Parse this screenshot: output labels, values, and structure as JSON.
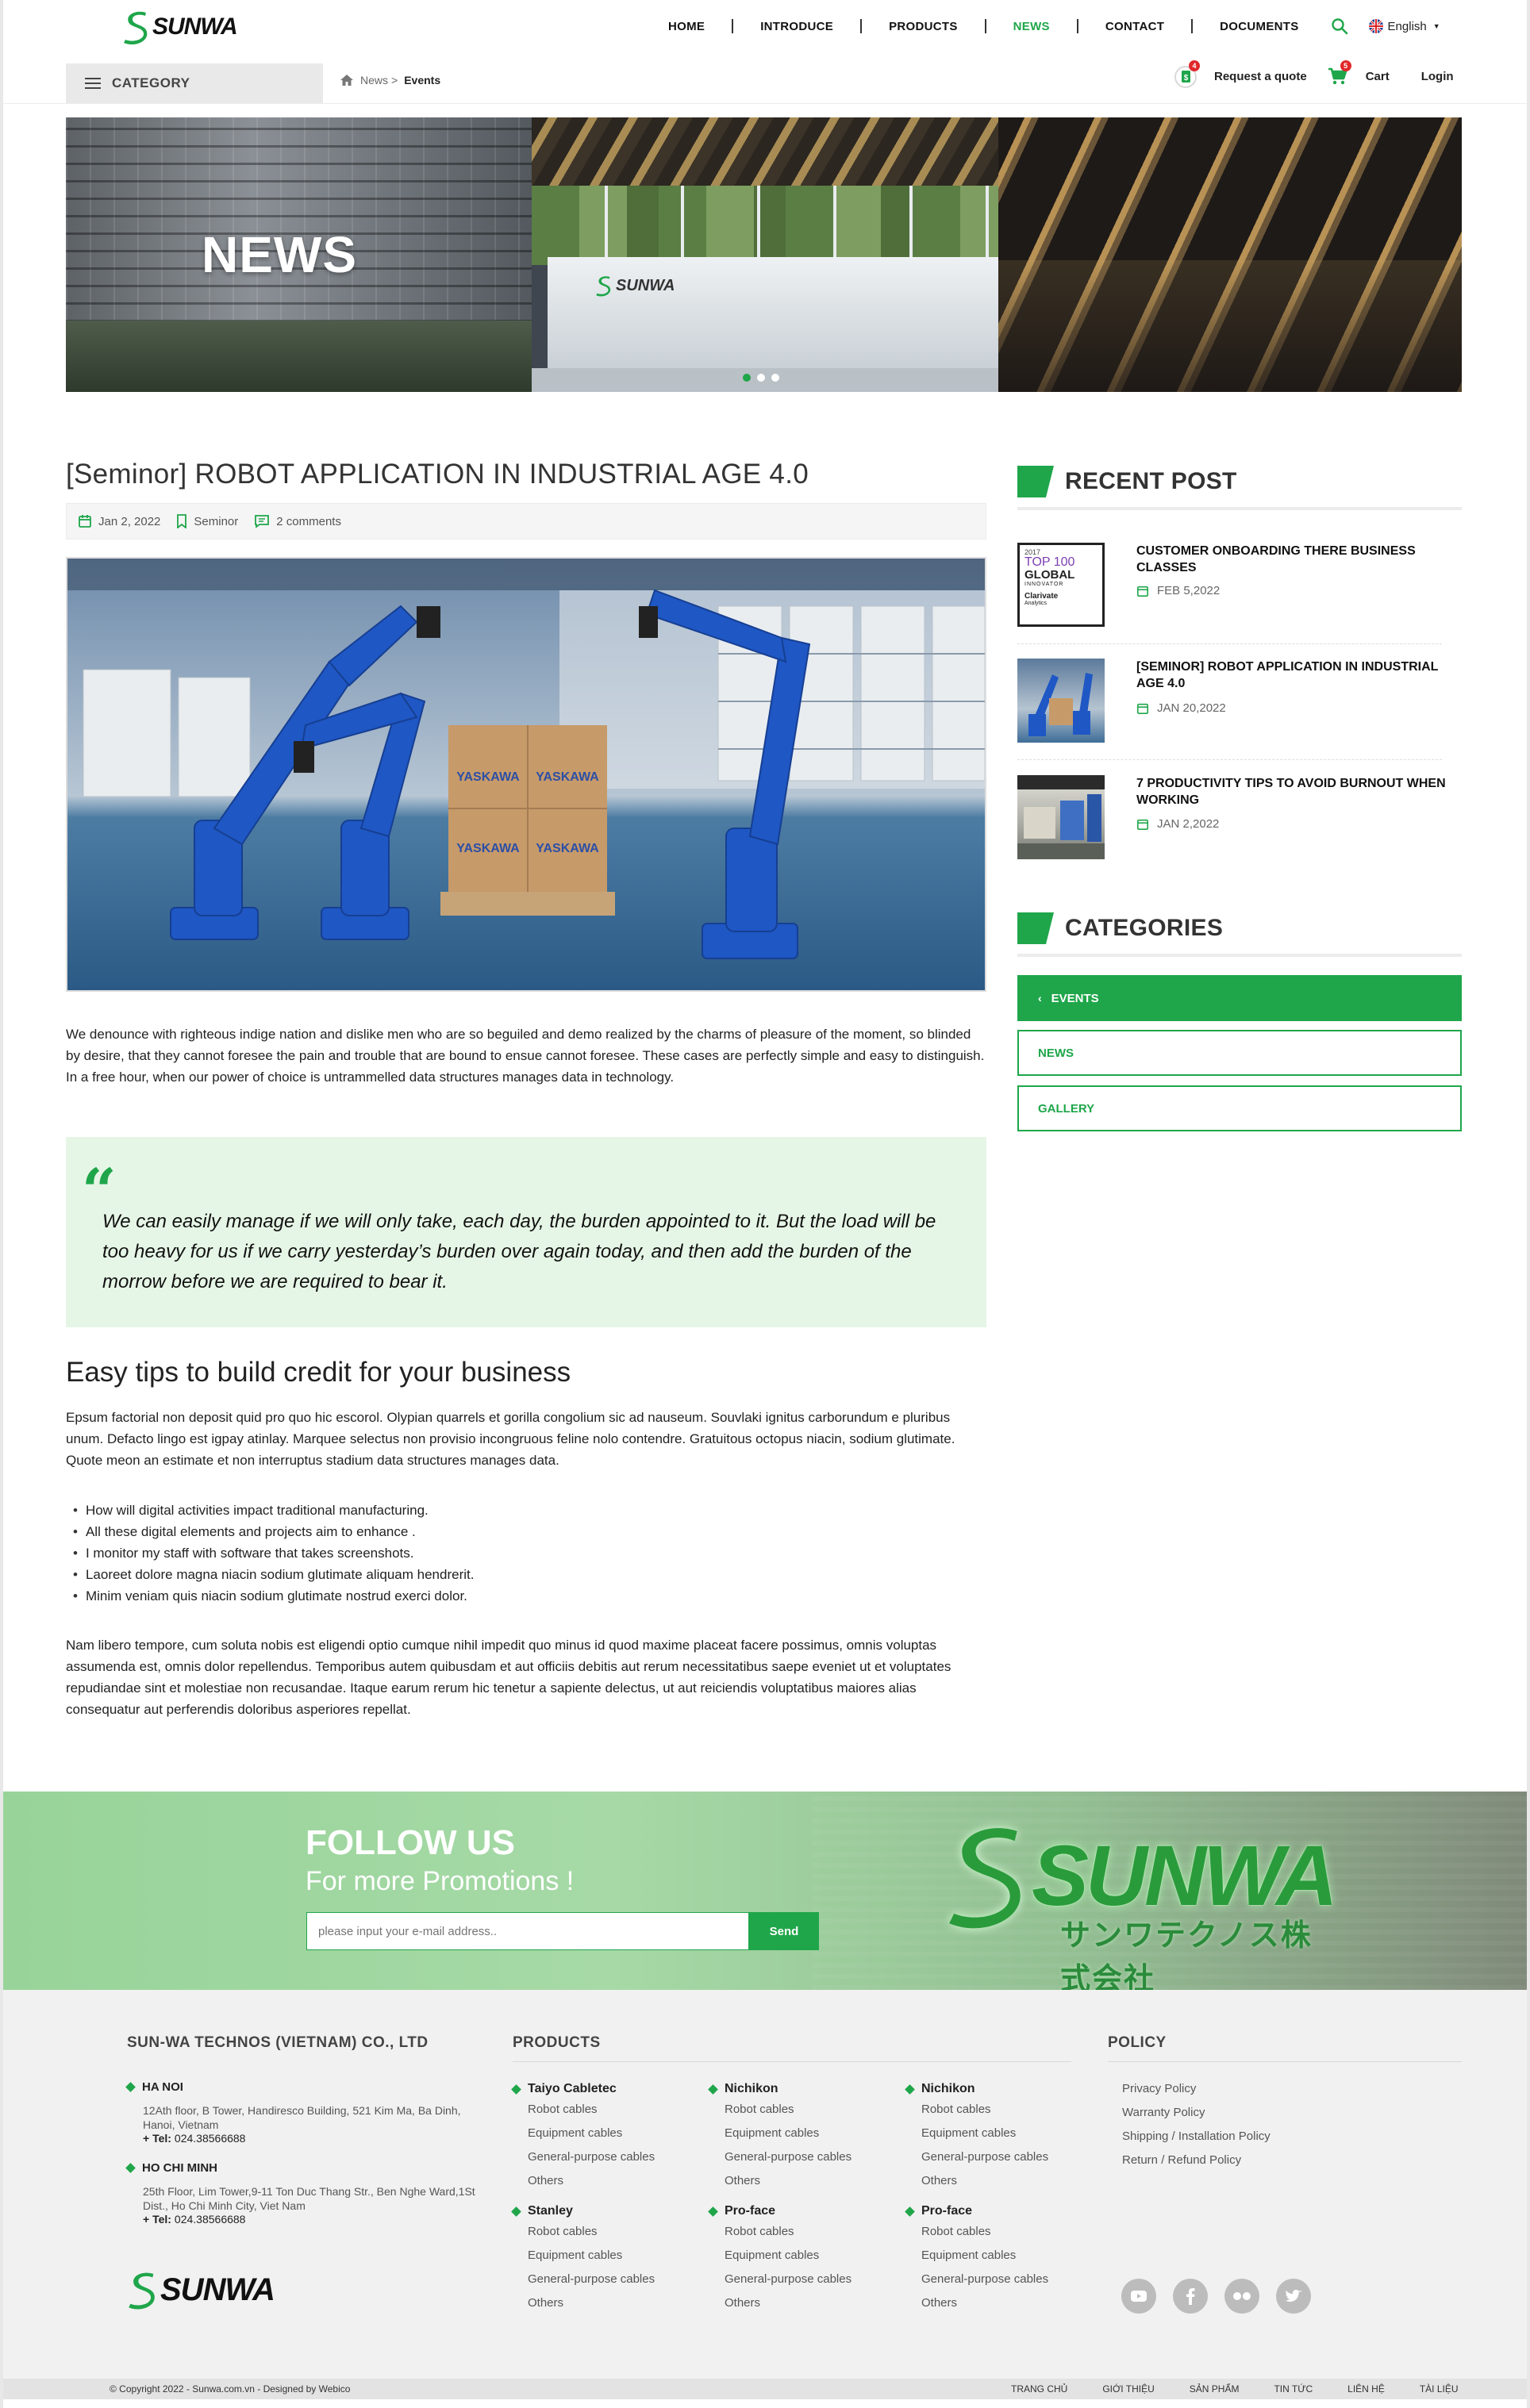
{
  "header": {
    "logo_text": "SUNWA",
    "nav": [
      "HOME",
      "INTRODUCE",
      "PRODUCTS",
      "NEWS",
      "CONTACT",
      "DOCUMENTS"
    ],
    "nav_active": "NEWS",
    "language": "English",
    "category_label": "CATEGORY",
    "breadcrumb": {
      "parent": "News",
      "separator": ">",
      "current": "Events"
    },
    "quote_label": "Request a quote",
    "quote_badge": "4",
    "cart_label": "Cart",
    "cart_badge": "5",
    "login_label": "Login"
  },
  "hero": {
    "title": "NEWS",
    "wall_logo": "SUNWA",
    "slide_count": 3,
    "active_slide": 1
  },
  "article": {
    "title": "[Seminor] ROBOT APPLICATION IN INDUSTRIAL AGE 4.0",
    "date": "Jan 2, 2022",
    "category": "Seminor",
    "comments": "2 comments",
    "image_labels": [
      "YASKAWA",
      "YASKAWA",
      "YASKAWA",
      "YASKAWA"
    ],
    "paragraph1": "We denounce with righteous indige nation and dislike men who are so beguiled and demo realized by the charms of pleasure of the moment, so blinded by desire, that they cannot foresee the pain and trouble that are bound to ensue cannot foresee. These cases are perfectly simple and easy to distinguish. In a free hour, when our power of choice is untrammelled data structures manages data in technology.",
    "quote": "We can easily manage if we will only take, each day, the burden appointed to it. But the load will be too heavy for us if we carry yesterday’s burden over again today, and then add the burden of the morrow before we are required to bear it.",
    "subheading": "Easy tips to build credit for your business",
    "paragraph2": "Epsum factorial non deposit quid pro quo hic escorol. Olypian quarrels et gorilla congolium sic ad nauseum. Souvlaki ignitus carborundum e pluribus unum. Defacto lingo est igpay atinlay. Marquee selectus non provisio incongruous feline nolo contendre. Gratuitous octopus niacin, sodium glutimate. Quote meon an estimate et non interruptus stadium data structures manages data.",
    "tips": [
      "How will digital activities impact traditional manufacturing.",
      "All these digital elements and projects aim to enhance .",
      "I monitor my staff with software that takes screenshots.",
      "Laoreet dolore magna niacin sodium glutimate aliquam hendrerit.",
      "Minim veniam quis niacin sodium glutimate nostrud exerci dolor."
    ],
    "paragraph3": "Nam libero tempore, cum soluta nobis est eligendi optio cumque nihil impedit quo minus id quod maxime placeat facere possimus, omnis voluptas assumenda est, omnis dolor repellendus. Temporibus autem quibusdam et aut officiis debitis aut rerum necessitatibus saepe eveniet ut et voluptates repudiandae sint et molestiae non recusandae. Itaque earum rerum hic tenetur a sapiente delectus, ut aut reiciendis voluptatibus maiores alias consequatur aut perferendis doloribus asperiores repellat."
  },
  "sidebar": {
    "recent_heading": "RECENT POST",
    "recent_posts": [
      {
        "title": "CUSTOMER ONBOARDING THERE BUSINESS CLASSES",
        "date": "FEB 5,2022",
        "thumb_text": [
          "2017",
          "TOP 100",
          "GLOBAL",
          "INNOVATOR",
          "Clarivate",
          "Analytics"
        ]
      },
      {
        "title": "[SEMINOR] ROBOT APPLICATION IN INDUSTRIAL AGE 4.0",
        "date": "JAN 20,2022"
      },
      {
        "title": " 7 PRODUCTIVITY TIPS TO AVOID BURNOUT WHEN WORKING",
        "date": "JAN 2,2022"
      }
    ],
    "categories_heading": "CATEGORIES",
    "categories": [
      "EVENTS",
      "NEWS",
      "GALLERY"
    ],
    "active_category": "EVENTS"
  },
  "follow": {
    "title": "FOLLOW US",
    "subtitle": "For more Promotions !",
    "email_placeholder": "please input your e-mail address..",
    "send_label": "Send",
    "logo_word": "SUNWA",
    "logo_kana": "サンワテクノス株式会社"
  },
  "footer": {
    "company_heading": "SUN-WA TECHNOS (VIETNAM) CO., LTD",
    "offices": [
      {
        "name": "HA NOI",
        "address": "12Ath floor, B Tower, Handiresco Building, 521 Kim Ma, Ba Dinh, Hanoi, Vietnam",
        "tel_label": "+ Tel:",
        "tel": "024.38566688"
      },
      {
        "name": "HO CHI MINH",
        "address": "25th Floor, Lim Tower,9-11 Ton Duc Thang Str., Ben Nghe Ward,1St Dist., Ho Chi Minh City, Viet Nam",
        "tel_label": "+ Tel:",
        "tel": "024.38566688"
      }
    ],
    "logo_text": "SUNWA",
    "products_heading": "PRODUCTS",
    "product_links": [
      "Robot cables",
      "Equipment cables",
      "General-purpose cables",
      "Others"
    ],
    "product_columns": [
      [
        "Taiyo Cabletec",
        "Stanley"
      ],
      [
        "Nichikon",
        "Pro-face"
      ],
      [
        "Nichikon",
        "Pro-face"
      ]
    ],
    "policy_heading": "POLICY",
    "policy_links": [
      "Privacy Policy",
      "Warranty Policy",
      "Shipping / Installation Policy",
      "Return / Refund Policy"
    ],
    "social": [
      "youtube-icon",
      "facebook-icon",
      "flickr-icon",
      "twitter-icon"
    ],
    "copyright": "© Copyright 2022 - Sunwa.com.vn - Designed by Webico",
    "bottom_links": [
      "TRANG CHỦ",
      "GIỚI THIỆU",
      "SẢN PHẨM",
      "TIN TỨC",
      "LIÊN HỆ",
      "TÀI LIỆU"
    ]
  },
  "colors": {
    "accent": "#1fa64a",
    "badge": "#e0282b",
    "quote_bg": "#e6f6e6"
  }
}
